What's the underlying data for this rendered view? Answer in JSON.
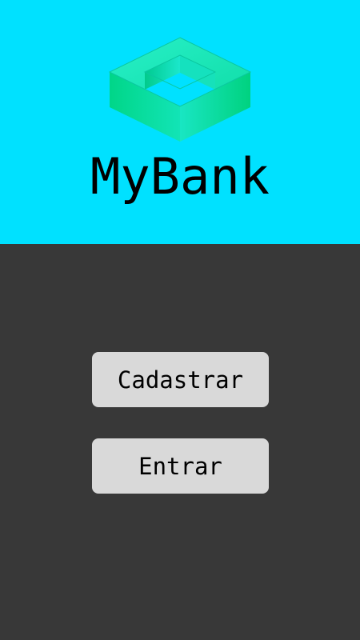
{
  "app": {
    "title": "MyBank",
    "logo_icon": "isometric-square-ring-logo"
  },
  "actions": {
    "register_label": "Cadastrar",
    "login_label": "Entrar"
  },
  "colors": {
    "header_background": "#00e1ff",
    "body_background": "#383838",
    "button_background": "#d9d9d9",
    "text": "#000000",
    "logo_green": "#00d68a",
    "logo_teal": "#13e8c6"
  }
}
